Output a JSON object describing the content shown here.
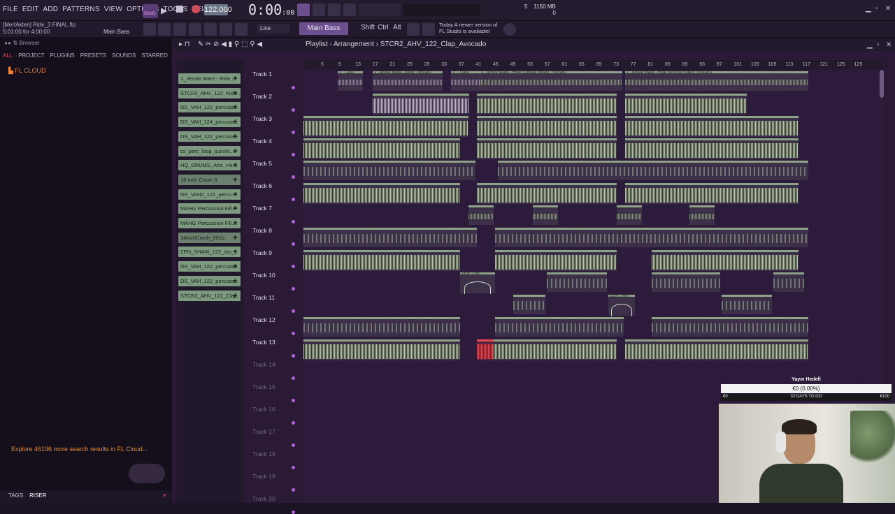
{
  "menu": [
    "FILE",
    "EDIT",
    "ADD",
    "PATTERNS",
    "VIEW",
    "OPTIONS",
    "TOOLS",
    "HELP"
  ],
  "transport": {
    "mode_badge": "SONG",
    "tempo": "122.000",
    "time_main": "0:00",
    "time_sub": ":00"
  },
  "system": {
    "cpu_value": "5",
    "memory": "1150 MB",
    "polyphony": "0"
  },
  "project": {
    "user_file": "[MertAkten] Ride_3 FINAL.flp",
    "selection": "5:01:00 for 4:00:00",
    "channel_hint": "Main Bass"
  },
  "toolbar2": {
    "snap": "Line",
    "pattern_name": "Main Bass",
    "keys": [
      "Shift",
      "Ctrl",
      "Alt"
    ],
    "update_line1": "Today  A newer version of",
    "update_line2": "FL Studio is available!"
  },
  "browser": {
    "header": "Browser",
    "tabs": [
      "ALL",
      "PROJECT",
      "PLUGINS",
      "PRESETS",
      "SOUNDS",
      "STARRED"
    ],
    "tree_root": "FL CLOUD",
    "explore_text": "Explore 46196 more search results in FL Cloud...",
    "tags_label": "TAGS",
    "tags_value": "RISER"
  },
  "playlist": {
    "breadcrumb": "Playlist - Arrangement",
    "pattern": "STCR2_AHV_122_Clap_Avocado",
    "ruler": [
      "5",
      "9",
      "13",
      "17",
      "21",
      "25",
      "29",
      "33",
      "37",
      "41",
      "45",
      "49",
      "53",
      "57",
      "61",
      "65",
      "69",
      "73",
      "77",
      "81",
      "85",
      "89",
      "93",
      "97",
      "101",
      "105",
      "109",
      "113",
      "117",
      "121",
      "125",
      "129"
    ],
    "picker": [
      "1_Jessie Ware - Ride ...",
      "STCR2_AHV_122_Kick...",
      "DS_VAH_122_percuss...",
      "DS_VAH_124_percuss...",
      "DS_VAH_122_percuss...",
      "cs_perc_loop_sunshi...",
      "HQ_DRUMS_Afro_Ho...",
      "16 inch Crash 3",
      "DS_VAH2_122_percu...",
      "MAHG Percussion Fill...",
      "MAHG Percussion Fill...",
      "14inchCrash_001b",
      "ZEN_SHAW_122_arp_...",
      "DS_VAH_122_percuss...",
      "DS_VAH_122_percuss...",
      "STCR2_AHV_122_Clap..."
    ],
    "tracks": [
      "Track 1",
      "Track 2",
      "Track 3",
      "Track 4",
      "Track 5",
      "Track 6",
      "Track 7",
      "Track 8",
      "Track 9",
      "Track 10",
      "Track 11",
      "Track 12",
      "Track 13",
      "Track 14",
      "Track 15",
      "Track 16",
      "Track 17",
      "Track 18",
      "Track 19",
      "Track 20"
    ],
    "clip_labels": {
      "vocal_a": "1_...als]",
      "vocal_b": "1_Jessie Ware...ideo]_[Vocals]",
      "vocal_c": "1_...cals]",
      "vocal_d": "1_Jessie Ware - Ride (Official Video]_[Vocals]",
      "vocal_e": "1_Jessie Ware - Ride (Official Video]_[Vocals]",
      "zen_a": "ZEN...min",
      "zen_b": "ZEN...min"
    }
  },
  "donation": {
    "title": "Yayın Hedefi",
    "amount": "€0 (0.00%)",
    "start": "€0",
    "days": "32 DAYS TO GO",
    "goal": "€100"
  },
  "colors": {
    "accent": "#b660e0",
    "clip_green": "#8ea288",
    "record_red": "#d04d5c",
    "highlight_red": "#e44b55",
    "cloud_orange": "#e6833a"
  }
}
